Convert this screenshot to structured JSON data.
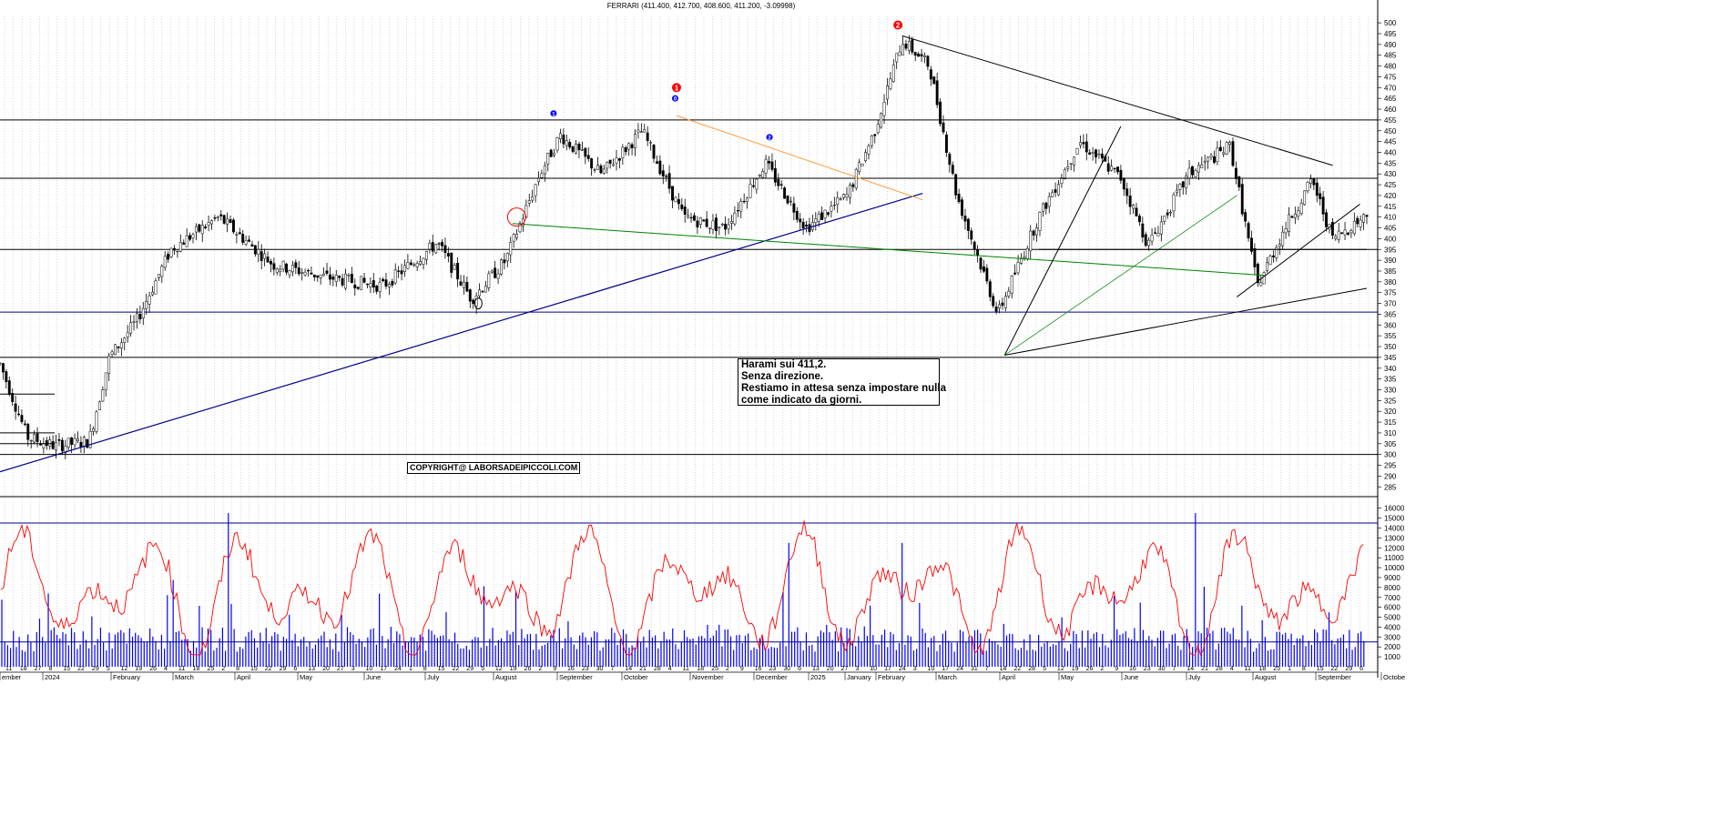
{
  "chart_data": {
    "type": "line",
    "title": "FERRARI (411.400, 412.700, 408.600, 411.200, -3.09998)",
    "price_axis": {
      "ticks": [
        285,
        290,
        295,
        300,
        305,
        310,
        315,
        320,
        325,
        330,
        335,
        340,
        345,
        350,
        355,
        360,
        365,
        370,
        375,
        380,
        385,
        390,
        395,
        400,
        405,
        410,
        415,
        420,
        425,
        430,
        435,
        440,
        445,
        450,
        455,
        460,
        465,
        470,
        475,
        480,
        485,
        490,
        495,
        500
      ],
      "range": [
        283,
        503
      ]
    },
    "volume_axis": {
      "ticks": [
        1000,
        2000,
        3000,
        4000,
        5000,
        6000,
        7000,
        8000,
        9000,
        10000,
        11000,
        12000,
        13000,
        14000,
        15000,
        16000
      ],
      "range": [
        0,
        16800
      ]
    },
    "month_labels": [
      "ember",
      "2024",
      "February",
      "March",
      "April",
      "May",
      "June",
      "July",
      "August",
      "September",
      "October",
      "November",
      "December",
      "2025",
      "January",
      "February",
      "March",
      "April",
      "May",
      "June",
      "July",
      "August",
      "September",
      "Octobe"
    ],
    "day_labels": [
      "11",
      "18",
      "27",
      "8",
      "15",
      "22",
      "29",
      "5",
      "12",
      "19",
      "26",
      "4",
      "11",
      "18",
      "25",
      "2",
      "8",
      "15",
      "22",
      "29",
      "6",
      "13",
      "20",
      "27",
      "3",
      "10",
      "17",
      "24",
      "1",
      "8",
      "15",
      "22",
      "29",
      "5",
      "12",
      "19",
      "26",
      "2",
      "9",
      "16",
      "23",
      "30",
      "7",
      "14",
      "21",
      "28",
      "4",
      "11",
      "18",
      "25",
      "2",
      "9",
      "16",
      "23",
      "30",
      "6",
      "13",
      "20",
      "27",
      "3",
      "10",
      "17",
      "24",
      "3",
      "10",
      "17",
      "24",
      "31",
      "7",
      "14",
      "22",
      "28",
      "5",
      "12",
      "19",
      "26",
      "2",
      "9",
      "16",
      "23",
      "30",
      "7",
      "14",
      "21",
      "28",
      "4",
      "11",
      "18",
      "25",
      "1",
      "8",
      "15",
      "22",
      "29",
      "6"
    ],
    "horizontal_levels": [
      455,
      428,
      395,
      366,
      345,
      300
    ],
    "wave_labels_red": [
      "1",
      "2"
    ],
    "wave_labels_blue": [
      "1",
      "0",
      "2"
    ],
    "price_series_anchor_points": [
      {
        "t": 0,
        "v": 342
      },
      {
        "t": 0.02,
        "v": 308
      },
      {
        "t": 0.04,
        "v": 304
      },
      {
        "t": 0.065,
        "v": 306
      },
      {
        "t": 0.08,
        "v": 345
      },
      {
        "t": 0.1,
        "v": 362
      },
      {
        "t": 0.125,
        "v": 395
      },
      {
        "t": 0.16,
        "v": 410
      },
      {
        "t": 0.2,
        "v": 388
      },
      {
        "t": 0.24,
        "v": 382
      },
      {
        "t": 0.28,
        "v": 378
      },
      {
        "t": 0.32,
        "v": 398
      },
      {
        "t": 0.345,
        "v": 372
      },
      {
        "t": 0.37,
        "v": 390
      },
      {
        "t": 0.395,
        "v": 430
      },
      {
        "t": 0.41,
        "v": 448
      },
      {
        "t": 0.44,
        "v": 430
      },
      {
        "t": 0.47,
        "v": 450
      },
      {
        "t": 0.5,
        "v": 410
      },
      {
        "t": 0.53,
        "v": 405
      },
      {
        "t": 0.56,
        "v": 435
      },
      {
        "t": 0.59,
        "v": 405
      },
      {
        "t": 0.62,
        "v": 420
      },
      {
        "t": 0.64,
        "v": 450
      },
      {
        "t": 0.66,
        "v": 492
      },
      {
        "t": 0.68,
        "v": 480
      },
      {
        "t": 0.7,
        "v": 420
      },
      {
        "t": 0.73,
        "v": 365
      },
      {
        "t": 0.76,
        "v": 410
      },
      {
        "t": 0.79,
        "v": 445
      },
      {
        "t": 0.82,
        "v": 428
      },
      {
        "t": 0.84,
        "v": 397
      },
      {
        "t": 0.87,
        "v": 430
      },
      {
        "t": 0.9,
        "v": 443
      },
      {
        "t": 0.92,
        "v": 378
      },
      {
        "t": 0.94,
        "v": 405
      },
      {
        "t": 0.96,
        "v": 427
      },
      {
        "t": 0.975,
        "v": 400
      },
      {
        "t": 1,
        "v": 411
      }
    ],
    "volume_baseline": 2500,
    "volume_upper_line": 14500,
    "oscillator_color": "#ff0000",
    "volume_color": "#0000ff"
  },
  "annotation": {
    "lines": [
      "Harami sui 411,2.",
      "Senza direzione.",
      "Restiamo in attesa senza impostare nulla",
      "come indicato da giorni."
    ]
  },
  "copyright": "COPYRIGHT@ LABORSADEIPICCOLI.COM"
}
